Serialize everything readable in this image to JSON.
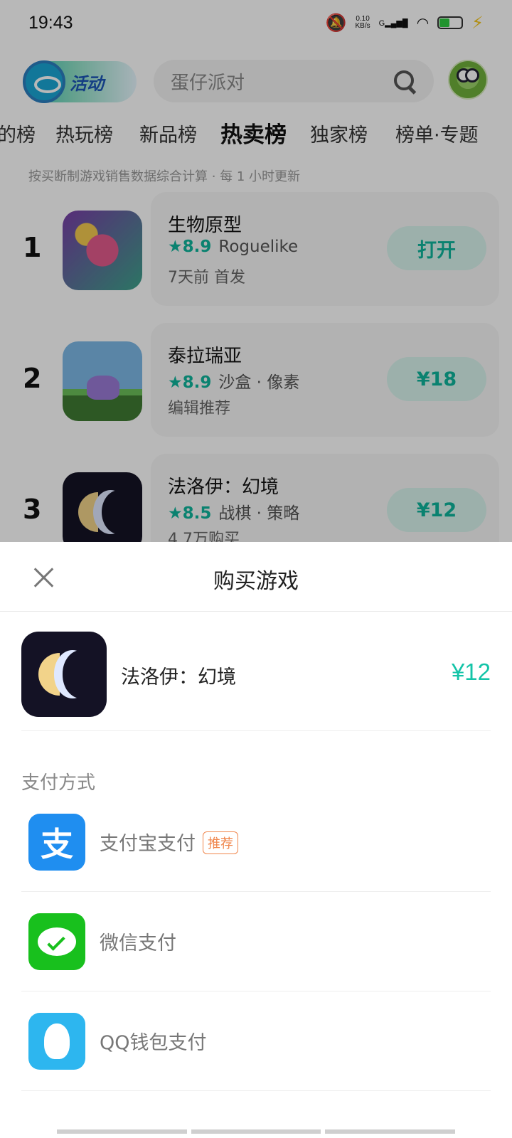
{
  "status_bar": {
    "time": "19:43",
    "speed_value": "0.10",
    "speed_unit": "KB/s",
    "network": "G"
  },
  "header": {
    "activity_label": "活动",
    "search_placeholder": "蛋仔派对"
  },
  "tabs": [
    "的榜",
    "热玩榜",
    "新品榜",
    "热卖榜",
    "独家榜",
    "榜单·专题"
  ],
  "active_tab": "热卖榜",
  "rank_note": "按买断制游戏销售数据综合计算 · 每 1 小时更新",
  "ranking": [
    {
      "rank": "1",
      "name": "生物原型",
      "score": "8.9",
      "tags": "Roguelike",
      "sub": "7天前 首发",
      "button": "打开"
    },
    {
      "rank": "2",
      "name": "泰拉瑞亚",
      "score": "8.9",
      "tags": "沙盒 · 像素",
      "sub": "编辑推荐",
      "button": "¥18"
    },
    {
      "rank": "3",
      "name": "法洛伊：幻境",
      "score": "8.5",
      "tags": "战棋 · 策略",
      "sub": "4.7万购买",
      "button": "¥12"
    }
  ],
  "sheet": {
    "title": "购买游戏",
    "product_name": "法洛伊：幻境",
    "product_price": "¥12",
    "pay_label": "支付方式",
    "methods": [
      {
        "name": "支付宝支付",
        "tag": "推荐",
        "icon": "alipay-icon",
        "glyph": "支"
      },
      {
        "name": "微信支付",
        "icon": "wechat-icon"
      },
      {
        "name": "QQ钱包支付",
        "icon": "qq-icon"
      }
    ]
  },
  "colors": {
    "accent": "#14c4a8",
    "alipay": "#1f8ef0",
    "wechat": "#18c01d",
    "qq": "#2db6ef",
    "tag": "#f0864c"
  }
}
